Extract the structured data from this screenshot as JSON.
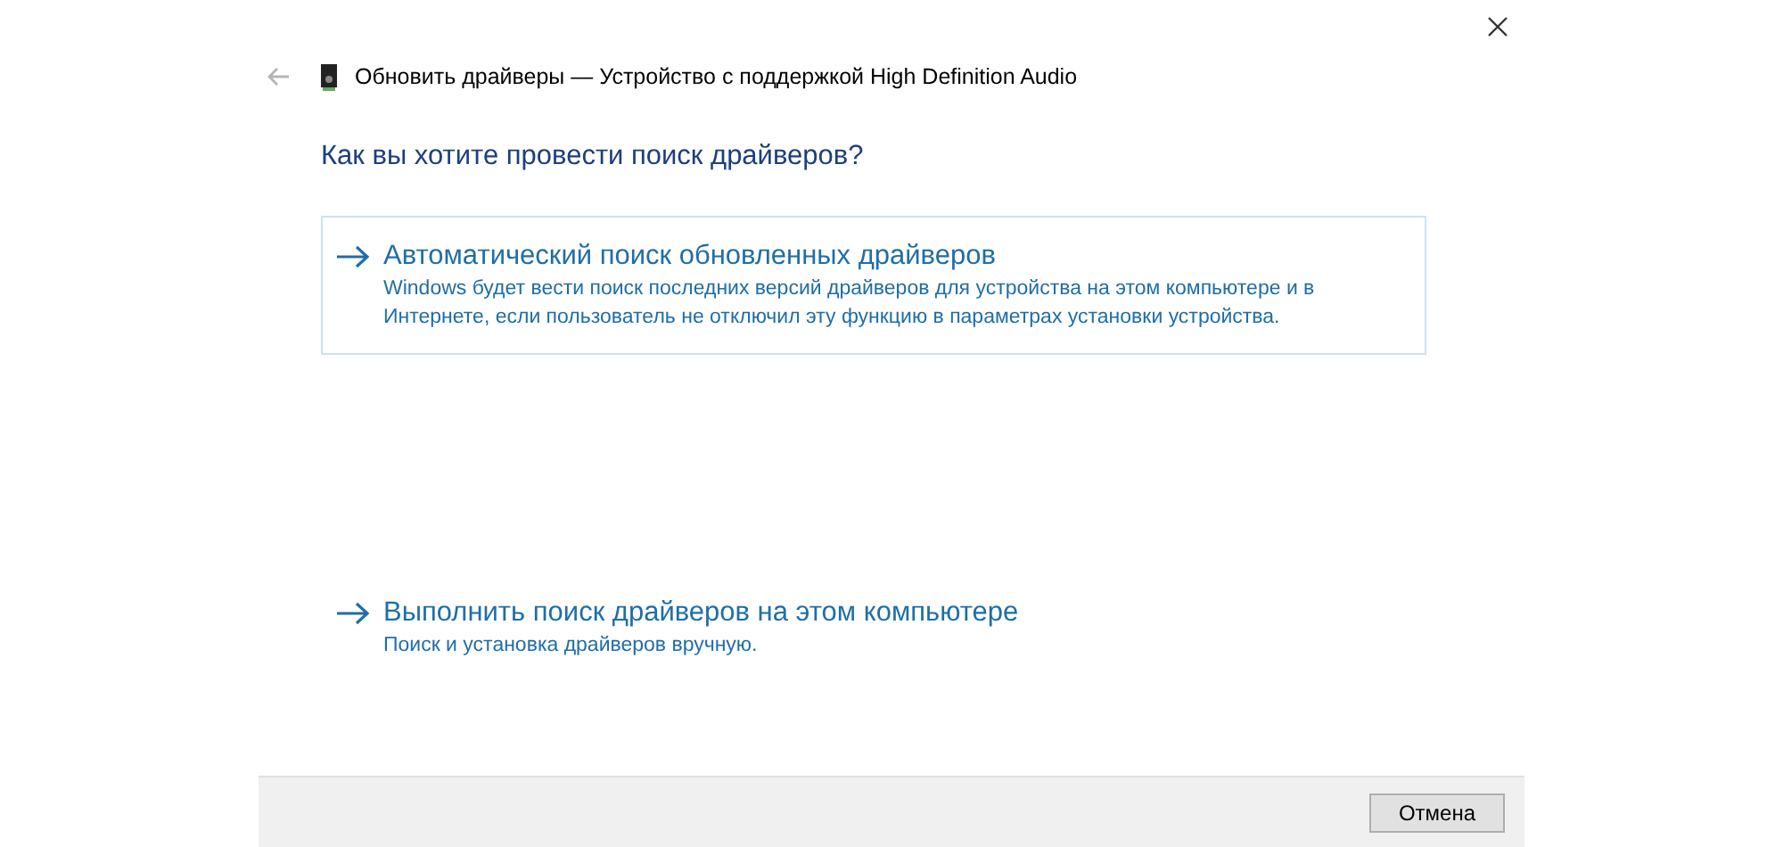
{
  "window": {
    "title": "Обновить драйверы — Устройство с поддержкой High Definition Audio",
    "back_disabled": true
  },
  "heading": "Как вы хотите провести поиск драйверов?",
  "options": [
    {
      "title": "Автоматический поиск обновленных драйверов",
      "description": "Windows будет вести поиск последних версий драйверов для устройства на этом компьютере и в Интернете, если пользователь не отключил эту функцию в параметрах установки устройства.",
      "selected": true
    },
    {
      "title": "Выполнить поиск драйверов на этом компьютере",
      "description": "Поиск и установка драйверов вручную.",
      "selected": false
    }
  ],
  "buttons": [
    "Отмена"
  ]
}
